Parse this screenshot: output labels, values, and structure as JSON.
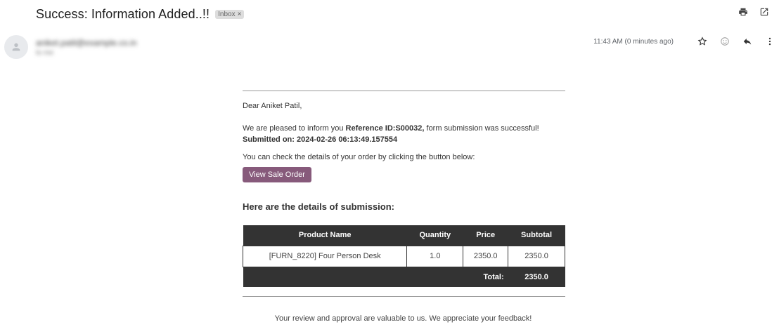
{
  "email": {
    "subject": "Success: Information Added..!!",
    "label": "Inbox",
    "label_remove": "×",
    "sender_name": "aniket.patil@example.co.in",
    "sender_to": "to me",
    "timestamp": "11:43 AM (0 minutes ago)"
  },
  "body": {
    "greeting": "Dear Aniket Patil,",
    "p1_a": "We are pleased to inform you ",
    "p1_ref": "Reference ID:S00032,",
    "p1_b": " form submission was successful! ",
    "p1_submitted": "Submitted on: 2024-02-26 06:13:49.157554",
    "p2": "You can check the details of your order by clicking the button below:",
    "button_label": "View Sale Order",
    "details_title": "Here are the details of submission:",
    "footer": "Your review and approval are valuable to us. We appreciate your feedback!"
  },
  "table": {
    "headers": [
      "Product Name",
      "Quantity",
      "Price",
      "Subtotal"
    ],
    "rows": [
      [
        "[FURN_8220] Four Person Desk",
        "1.0",
        "2350.0",
        "2350.0"
      ]
    ],
    "total_label": "Total:",
    "total_value": "2350.0"
  },
  "colors": {
    "button": "#875a7b",
    "table_header": "#333333"
  },
  "icons": {
    "top": [
      "print-icon",
      "open-new-window-icon"
    ],
    "meta": [
      "star-icon",
      "emoji-icon",
      "reply-icon",
      "more-vert-icon"
    ]
  }
}
